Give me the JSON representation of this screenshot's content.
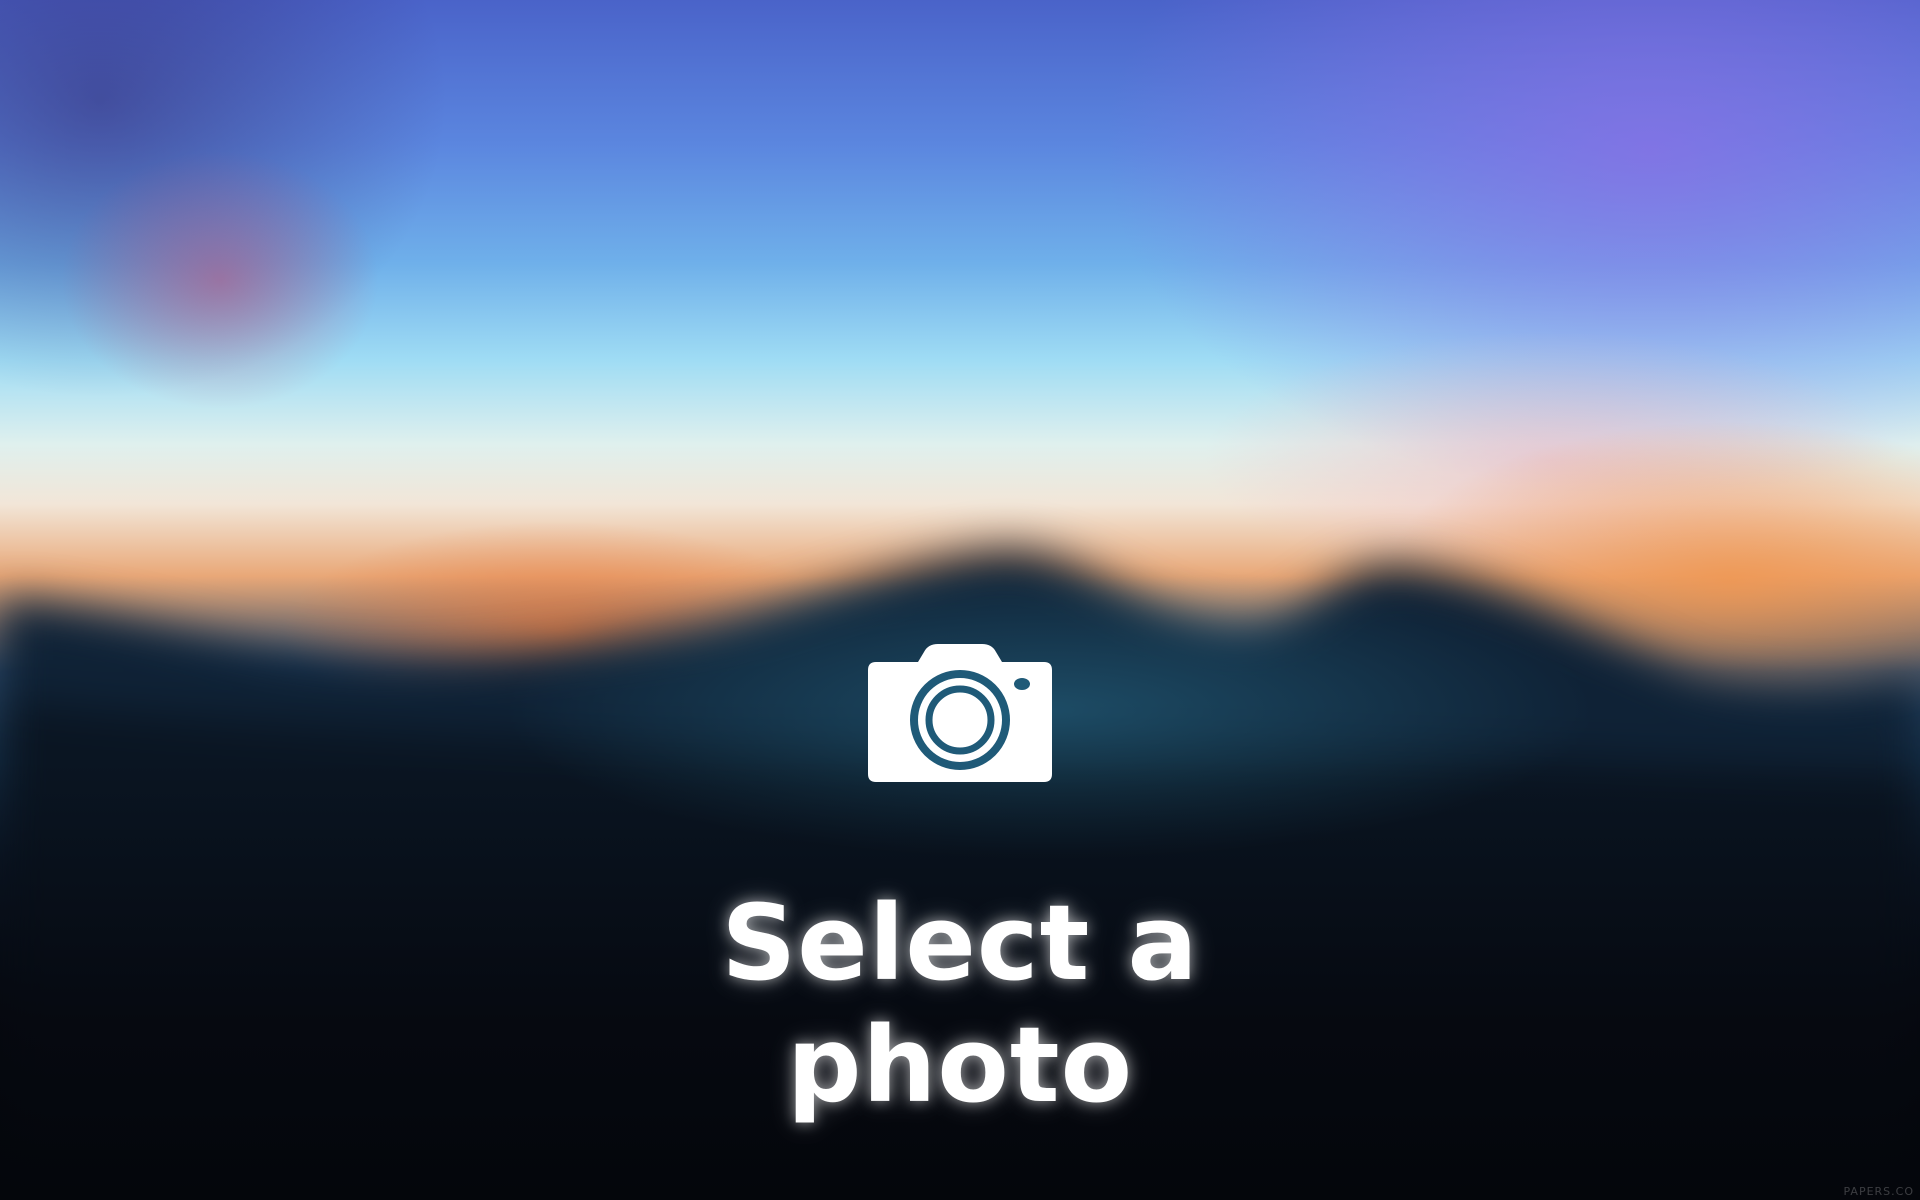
{
  "screen": {
    "prompt_label": "Select a photo",
    "icon": "camera-icon",
    "watermark_text": "PAPERS.CO"
  },
  "colors": {
    "text": "#ffffff",
    "camera_body": "#ffffff",
    "camera_lens": "#1f5a78",
    "sky_top": "#4a63c9",
    "horizon_glow": "#e9a878",
    "ground": "#05070d"
  }
}
